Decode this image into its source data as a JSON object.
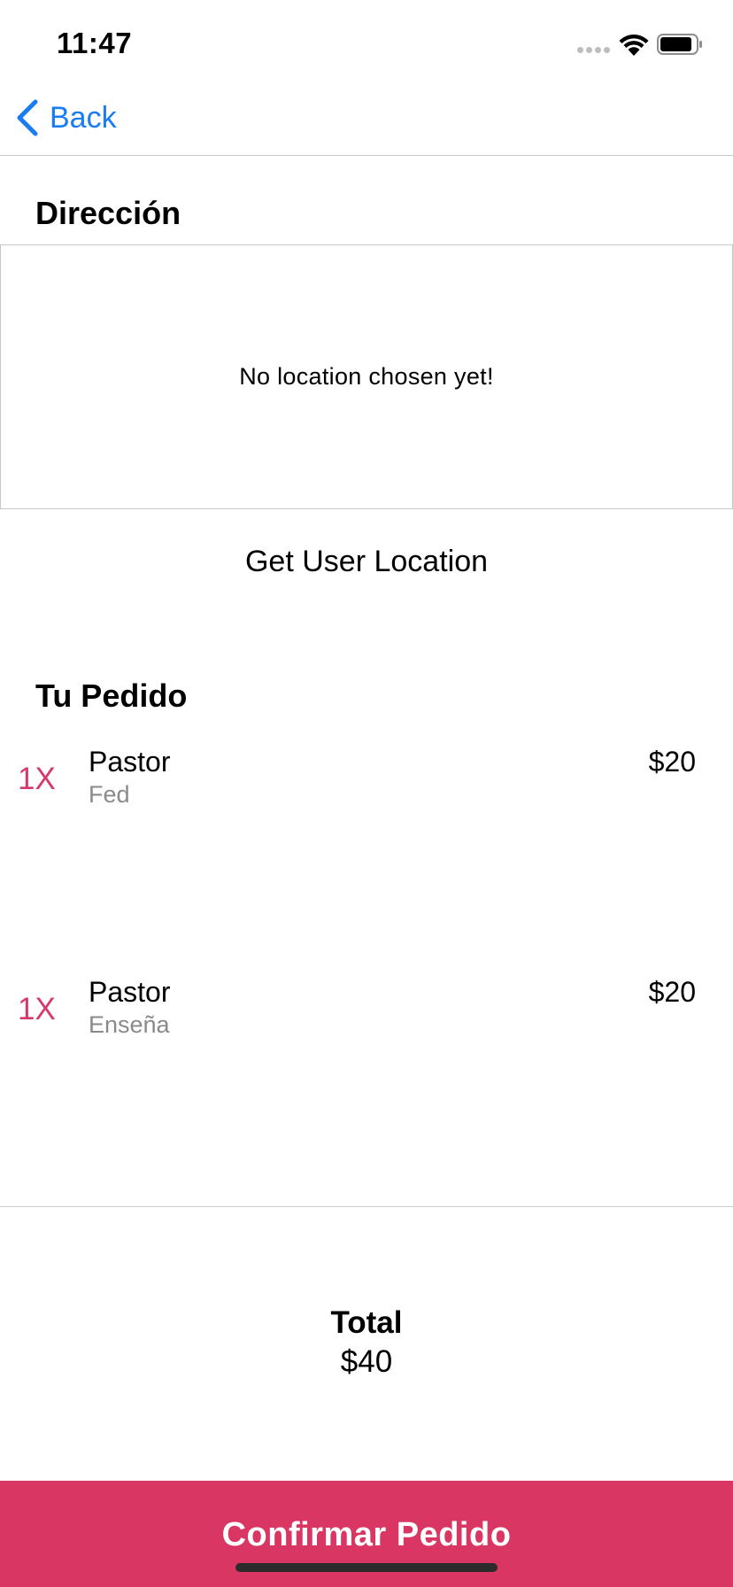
{
  "status_bar": {
    "time": "11:47"
  },
  "nav": {
    "back_label": "Back"
  },
  "address": {
    "title": "Dirección",
    "map_placeholder": "No location chosen yet!",
    "get_location_label": "Get User Location"
  },
  "order": {
    "title": "Tu Pedido",
    "items": [
      {
        "qty": "1X",
        "name": "Pastor",
        "note": "Fed",
        "price": "$20"
      },
      {
        "qty": "1X",
        "name": "Pastor",
        "note": "Enseña",
        "price": "$20"
      }
    ]
  },
  "total": {
    "label": "Total",
    "value": "$40"
  },
  "confirm": {
    "label": "Confirmar Pedido"
  },
  "colors": {
    "accent": "#d93664",
    "link": "#1a7cf5",
    "muted_text": "#8a8a8a"
  }
}
